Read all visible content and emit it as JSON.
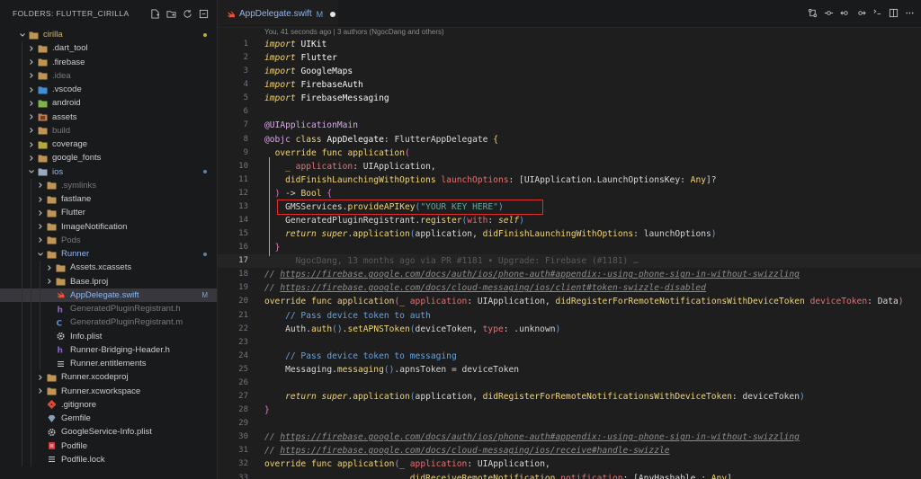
{
  "explorer": {
    "title": "FOLDERS: FLUTTER_CIRILLA",
    "items": [
      {
        "label": "cirilla",
        "depth": 0,
        "type": "folder",
        "open": true,
        "state": "git",
        "dot": "#c9a23b"
      },
      {
        "label": ".dart_tool",
        "depth": 1,
        "type": "folder",
        "state": "normal"
      },
      {
        "label": ".firebase",
        "depth": 1,
        "type": "folder",
        "state": "normal"
      },
      {
        "label": ".idea",
        "depth": 1,
        "type": "folder",
        "state": "dim"
      },
      {
        "label": ".vscode",
        "depth": 1,
        "type": "vscode",
        "state": "normal"
      },
      {
        "label": "android",
        "depth": 1,
        "type": "android",
        "state": "normal"
      },
      {
        "label": "assets",
        "depth": 1,
        "type": "assets",
        "state": "normal"
      },
      {
        "label": "build",
        "depth": 1,
        "type": "folder",
        "state": "dim"
      },
      {
        "label": "coverage",
        "depth": 1,
        "type": "coverage",
        "state": "normal"
      },
      {
        "label": "google_fonts",
        "depth": 1,
        "type": "folder",
        "state": "normal"
      },
      {
        "label": "ios",
        "depth": 1,
        "type": "ios",
        "open": true,
        "state": "mod",
        "dot": "#5a7fae"
      },
      {
        "label": ".symlinks",
        "depth": 2,
        "type": "folder",
        "state": "dim"
      },
      {
        "label": "fastlane",
        "depth": 2,
        "type": "folder",
        "state": "normal"
      },
      {
        "label": "Flutter",
        "depth": 2,
        "type": "folder",
        "state": "normal"
      },
      {
        "label": "ImageNotification",
        "depth": 2,
        "type": "folder",
        "state": "normal"
      },
      {
        "label": "Pods",
        "depth": 2,
        "type": "folder",
        "state": "dim"
      },
      {
        "label": "Runner",
        "depth": 2,
        "type": "folder",
        "open": true,
        "state": "mod",
        "dot": "#5a7fae"
      },
      {
        "label": "Assets.xcassets",
        "depth": 3,
        "type": "folder",
        "state": "normal"
      },
      {
        "label": "Base.lproj",
        "depth": 3,
        "type": "folder",
        "state": "normal"
      },
      {
        "label": "AppDelegate.swift",
        "depth": 3,
        "type": "swift",
        "state": "mod",
        "badge": "M",
        "selected": true
      },
      {
        "label": "GeneratedPluginRegistrant.h",
        "depth": 3,
        "type": "h",
        "state": "dim"
      },
      {
        "label": "GeneratedPluginRegistrant.m",
        "depth": 3,
        "type": "m",
        "state": "dim"
      },
      {
        "label": "Info.plist",
        "depth": 3,
        "type": "gear",
        "state": "normal"
      },
      {
        "label": "Runner-Bridging-Header.h",
        "depth": 3,
        "type": "h",
        "state": "normal"
      },
      {
        "label": "Runner.entitlements",
        "depth": 3,
        "type": "lines",
        "state": "normal"
      },
      {
        "label": "Runner.xcodeproj",
        "depth": 2,
        "type": "folder",
        "state": "normal"
      },
      {
        "label": "Runner.xcworkspace",
        "depth": 2,
        "type": "folder",
        "state": "normal"
      },
      {
        "label": ".gitignore",
        "depth": 2,
        "type": "git",
        "state": "normal"
      },
      {
        "label": "Gemfile",
        "depth": 2,
        "type": "gem",
        "state": "normal"
      },
      {
        "label": "GoogleService-Info.plist",
        "depth": 2,
        "type": "gear",
        "state": "normal"
      },
      {
        "label": "Podfile",
        "depth": 2,
        "type": "podfile",
        "state": "normal"
      },
      {
        "label": "Podfile.lock",
        "depth": 2,
        "type": "lines",
        "state": "normal"
      }
    ]
  },
  "tab": {
    "label": "AppDelegate.swift",
    "status": "M"
  },
  "blame_header": "You, 41 seconds ago | 3 authors (NgocDang and others)",
  "inline_blame": "NgocDang, 13 months ago via PR #1181 • Upgrade: Firebase (#1181) …",
  "code": {
    "current_line": 17,
    "lines": [
      {
        "n": 1,
        "tokens": [
          [
            "kw",
            "import"
          ],
          [
            "",
            " "
          ],
          [
            "ty",
            "UIKit"
          ]
        ]
      },
      {
        "n": 2,
        "tokens": [
          [
            "kw",
            "import"
          ],
          [
            "",
            " "
          ],
          [
            "ty",
            "Flutter"
          ]
        ]
      },
      {
        "n": 3,
        "tokens": [
          [
            "kw",
            "import"
          ],
          [
            "",
            " "
          ],
          [
            "ty",
            "GoogleMaps"
          ]
        ]
      },
      {
        "n": 4,
        "tokens": [
          [
            "kw",
            "import"
          ],
          [
            "",
            " "
          ],
          [
            "ty",
            "FirebaseAuth"
          ]
        ]
      },
      {
        "n": 5,
        "tokens": [
          [
            "kw",
            "import"
          ],
          [
            "",
            " "
          ],
          [
            "ty",
            "FirebaseMessaging"
          ]
        ]
      },
      {
        "n": 6,
        "tokens": []
      },
      {
        "n": 7,
        "tokens": [
          [
            "at",
            "@UIApplicationMain"
          ]
        ]
      },
      {
        "n": 8,
        "tokens": [
          [
            "at",
            "@objc"
          ],
          [
            "",
            " "
          ],
          [
            "kwn",
            "class"
          ],
          [
            "",
            " "
          ],
          [
            "ty",
            "AppDelegate"
          ],
          [
            "",
            ": "
          ],
          [
            "lbl",
            "FlutterAppDelegate"
          ],
          [
            "",
            " "
          ],
          [
            "br1",
            "{"
          ]
        ]
      },
      {
        "n": 9,
        "tokens": [
          [
            "",
            "  "
          ],
          [
            "kwn",
            "override"
          ],
          [
            "",
            " "
          ],
          [
            "kwn",
            "func"
          ],
          [
            "",
            " "
          ],
          [
            "fn",
            "application"
          ],
          [
            "br2",
            "("
          ]
        ]
      },
      {
        "n": 10,
        "tokens": [
          [
            "",
            "    "
          ],
          [
            "fn",
            "_"
          ],
          [
            "",
            " "
          ],
          [
            "pr",
            "application"
          ],
          [
            "",
            ": "
          ],
          [
            "lbl",
            "UIApplication"
          ],
          [
            "",
            ","
          ]
        ]
      },
      {
        "n": 11,
        "tokens": [
          [
            "",
            "    "
          ],
          [
            "fn",
            "didFinishLaunchingWithOptions"
          ],
          [
            "",
            " "
          ],
          [
            "pr",
            "launchOptions"
          ],
          [
            "",
            ": ["
          ],
          [
            "lbl",
            "UIApplication.LaunchOptionsKey"
          ],
          [
            "",
            ": "
          ],
          [
            "fn",
            "Any"
          ],
          [
            "",
            "]?"
          ]
        ]
      },
      {
        "n": 12,
        "tokens": [
          [
            "",
            "  "
          ],
          [
            "br2",
            ")"
          ],
          [
            "",
            " -> "
          ],
          [
            "fn",
            "Bool"
          ],
          [
            "",
            " "
          ],
          [
            "br2",
            "{"
          ]
        ]
      },
      {
        "n": 13,
        "tokens": [
          [
            "",
            "    "
          ],
          [
            "lbl",
            "GMSServices"
          ],
          [
            "",
            "."
          ],
          [
            "fn",
            "provideAPIKey"
          ],
          [
            "br3",
            "("
          ],
          [
            "str",
            "\"YOUR KEY HERE\""
          ],
          [
            "br3",
            ")"
          ]
        ]
      },
      {
        "n": 14,
        "tokens": [
          [
            "",
            "    "
          ],
          [
            "lbl",
            "GeneratedPluginRegistrant"
          ],
          [
            "",
            "."
          ],
          [
            "fn",
            "register"
          ],
          [
            "br3",
            "("
          ],
          [
            "pr",
            "with"
          ],
          [
            "",
            ": "
          ],
          [
            "kw",
            "self"
          ],
          [
            "br3",
            ")"
          ]
        ]
      },
      {
        "n": 15,
        "tokens": [
          [
            "",
            "    "
          ],
          [
            "kw",
            "return"
          ],
          [
            "",
            " "
          ],
          [
            "kw",
            "super"
          ],
          [
            "",
            "."
          ],
          [
            "fn",
            "application"
          ],
          [
            "br3",
            "("
          ],
          [
            "lbl",
            "application, "
          ],
          [
            "fn",
            "didFinishLaunchingWithOptions"
          ],
          [
            "",
            ": launchOptions"
          ],
          [
            "br3",
            ")"
          ]
        ]
      },
      {
        "n": 16,
        "tokens": [
          [
            "",
            "  "
          ],
          [
            "br2",
            "}"
          ]
        ]
      },
      {
        "n": 17,
        "tokens": [
          [
            "",
            "      "
          ],
          [
            "inline-blame",
            "__BLAME__"
          ]
        ]
      },
      {
        "n": 18,
        "tokens": [
          [
            "com",
            "// "
          ],
          [
            "url",
            "https://firebase.google.com/docs/auth/ios/phone-auth#appendix:-using-phone-sign-in-without-swizzling"
          ]
        ]
      },
      {
        "n": 19,
        "tokens": [
          [
            "com",
            "// "
          ],
          [
            "url",
            "https://firebase.google.com/docs/cloud-messaging/ios/client#token-swizzle-disabled"
          ]
        ]
      },
      {
        "n": 20,
        "tokens": [
          [
            "kwn",
            "override"
          ],
          [
            "",
            " "
          ],
          [
            "kwn",
            "func"
          ],
          [
            "",
            " "
          ],
          [
            "fn",
            "application"
          ],
          [
            "br2",
            "("
          ],
          [
            "fn",
            "_"
          ],
          [
            "",
            " "
          ],
          [
            "pr",
            "application"
          ],
          [
            "",
            ": "
          ],
          [
            "lbl",
            "UIApplication"
          ],
          [
            "",
            ", "
          ],
          [
            "fn",
            "didRegisterForRemoteNotificationsWithDeviceToken"
          ],
          [
            "",
            " "
          ],
          [
            "pr",
            "deviceToken"
          ],
          [
            "",
            ": "
          ],
          [
            "lbl",
            "Data"
          ],
          [
            "br2",
            ")"
          ]
        ]
      },
      {
        "n": 21,
        "tokens": [
          [
            "",
            "    "
          ],
          [
            "cmt-blue",
            "// Pass device token to auth"
          ]
        ]
      },
      {
        "n": 22,
        "tokens": [
          [
            "",
            "    "
          ],
          [
            "lbl",
            "Auth"
          ],
          [
            "",
            "."
          ],
          [
            "fn",
            "auth"
          ],
          [
            "br3",
            "()"
          ],
          [
            "",
            "."
          ],
          [
            "fn",
            "setAPNSToken"
          ],
          [
            "br3",
            "("
          ],
          [
            "lbl",
            "deviceToken, "
          ],
          [
            "pr",
            "type"
          ],
          [
            "",
            ": .unknown"
          ],
          [
            "br3",
            ")"
          ]
        ]
      },
      {
        "n": 23,
        "tokens": []
      },
      {
        "n": 24,
        "tokens": [
          [
            "",
            "    "
          ],
          [
            "cmt-blue",
            "// Pass device token to messaging"
          ]
        ]
      },
      {
        "n": 25,
        "tokens": [
          [
            "",
            "    "
          ],
          [
            "lbl",
            "Messaging"
          ],
          [
            "",
            "."
          ],
          [
            "fn",
            "messaging"
          ],
          [
            "br3",
            "()"
          ],
          [
            "",
            ".apnsToken = deviceToken"
          ]
        ]
      },
      {
        "n": 26,
        "tokens": []
      },
      {
        "n": 27,
        "tokens": [
          [
            "",
            "    "
          ],
          [
            "kw",
            "return"
          ],
          [
            "",
            " "
          ],
          [
            "kw",
            "super"
          ],
          [
            "",
            "."
          ],
          [
            "fn",
            "application"
          ],
          [
            "br3",
            "("
          ],
          [
            "lbl",
            "application, "
          ],
          [
            "fn",
            "didRegisterForRemoteNotificationsWithDeviceToken"
          ],
          [
            "",
            ": deviceToken"
          ],
          [
            "br3",
            ")"
          ]
        ]
      },
      {
        "n": 28,
        "tokens": [
          [
            "br2",
            "}"
          ]
        ]
      },
      {
        "n": 29,
        "tokens": []
      },
      {
        "n": 30,
        "tokens": [
          [
            "com",
            "// "
          ],
          [
            "url",
            "https://firebase.google.com/docs/auth/ios/phone-auth#appendix:-using-phone-sign-in-without-swizzling"
          ]
        ]
      },
      {
        "n": 31,
        "tokens": [
          [
            "com",
            "// "
          ],
          [
            "url",
            "https://firebase.google.com/docs/cloud-messaging/ios/receive#handle-swizzle"
          ]
        ]
      },
      {
        "n": 32,
        "tokens": [
          [
            "kwn",
            "override"
          ],
          [
            "",
            " "
          ],
          [
            "kwn",
            "func"
          ],
          [
            "",
            " "
          ],
          [
            "fn",
            "application"
          ],
          [
            "br2",
            "("
          ],
          [
            "fn",
            "_"
          ],
          [
            "",
            " "
          ],
          [
            "pr",
            "application"
          ],
          [
            "",
            ": "
          ],
          [
            "lbl",
            "UIApplication"
          ],
          [
            "",
            ","
          ]
        ]
      },
      {
        "n": 33,
        "tokens": [
          [
            "",
            "                            "
          ],
          [
            "fn",
            "didReceiveRemoteNotification"
          ],
          [
            "",
            " "
          ],
          [
            "pr",
            "notification"
          ],
          [
            "",
            ": ["
          ],
          [
            "lbl",
            "AnyHashable"
          ],
          [
            "",
            " : "
          ],
          [
            "fn",
            "Any"
          ],
          [
            "",
            "],"
          ]
        ]
      }
    ]
  },
  "highlight": {
    "line": 13
  },
  "colors": {
    "accent": "#8fb8ef",
    "highlight_box": "#e02c2c",
    "git_modified": "#7aa1d2"
  }
}
